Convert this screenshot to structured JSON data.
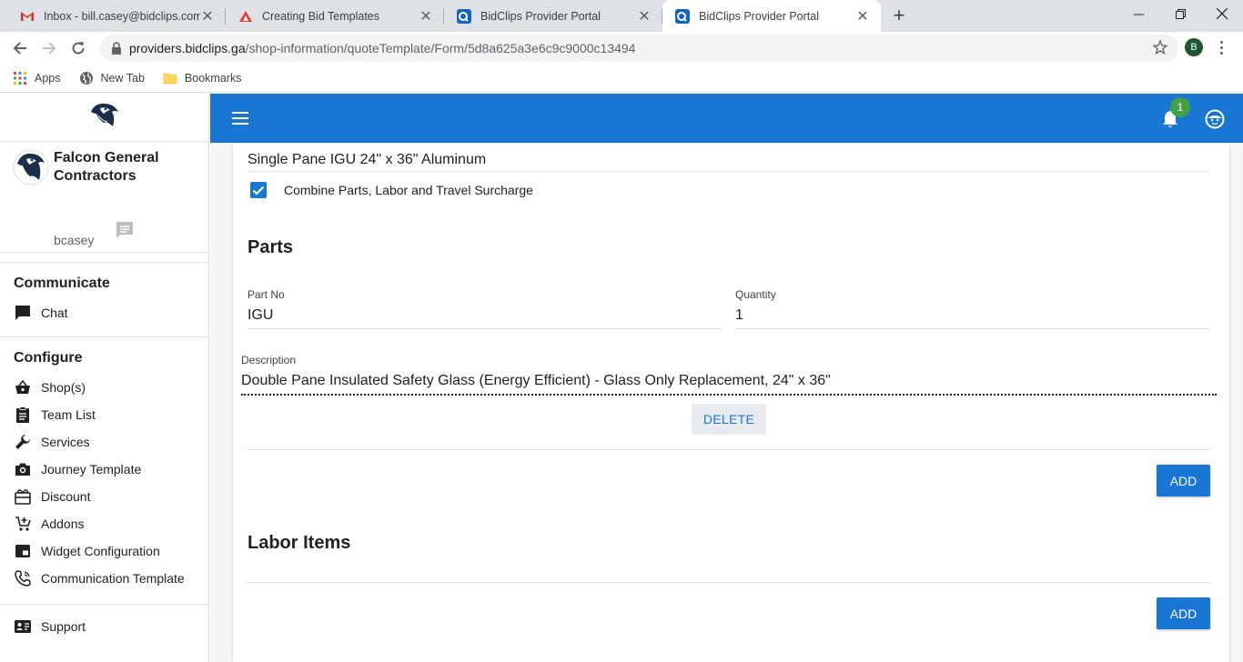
{
  "browser": {
    "tabs": [
      {
        "title": "Inbox - bill.casey@bidclips.com -",
        "icon": "gmail-icon",
        "active": false
      },
      {
        "title": "Creating Bid Templates",
        "icon": "docs-icon",
        "active": false
      },
      {
        "title": "BidClips Provider Portal",
        "icon": "bidclips-icon",
        "active": false
      },
      {
        "title": "BidClips Provider Portal",
        "icon": "bidclips-icon",
        "active": true
      }
    ],
    "url_host": "providers.bidclips.ga",
    "url_path": "/shop-information/quoteTemplate/Form/5d8a625a3e6c9c9000c13494",
    "profile_initial": "B",
    "bookmarks": [
      {
        "label": "Apps",
        "icon": "apps-grid-icon"
      },
      {
        "label": "New Tab",
        "icon": "globe-icon"
      },
      {
        "label": "Bookmarks",
        "icon": "folder-icon"
      }
    ]
  },
  "sidebar": {
    "company": "Falcon General Contractors",
    "username": "bcasey",
    "sections": [
      {
        "heading": "Communicate",
        "items": [
          {
            "label": "Chat",
            "icon": "chat-icon"
          }
        ]
      },
      {
        "heading": "Configure",
        "items": [
          {
            "label": "Shop(s)",
            "icon": "basket-icon"
          },
          {
            "label": "Team List",
            "icon": "clipboard-icon"
          },
          {
            "label": "Services",
            "icon": "wrench-icon"
          },
          {
            "label": "Journey Template",
            "icon": "camera-icon"
          },
          {
            "label": "Discount",
            "icon": "gift-icon"
          },
          {
            "label": "Addons",
            "icon": "cart-add-icon"
          },
          {
            "label": "Widget Configuration",
            "icon": "widget-icon"
          },
          {
            "label": "Communication Template",
            "icon": "phone-icon"
          }
        ]
      }
    ],
    "support": {
      "label": "Support",
      "icon": "contact-card-icon"
    }
  },
  "appbar": {
    "notification_count": "1"
  },
  "form": {
    "template_name": "Single Pane IGU 24\" x 36\" Aluminum",
    "combine_checkbox": {
      "label": "Combine Parts, Labor and Travel Surcharge",
      "checked": true
    },
    "parts": {
      "title": "Parts",
      "part_no_label": "Part No",
      "part_no_value": "IGU",
      "quantity_label": "Quantity",
      "quantity_value": "1",
      "description_label": "Description",
      "description_value": "Double Pane Insulated Safety Glass (Energy Efficient) - Glass Only Replacement, 24\" x 36\"",
      "delete_label": "DELETE",
      "add_label": "ADD"
    },
    "labor": {
      "title": "Labor Items",
      "add_label": "ADD"
    }
  },
  "colors": {
    "primary": "#1976d2",
    "badge": "#43a047"
  }
}
